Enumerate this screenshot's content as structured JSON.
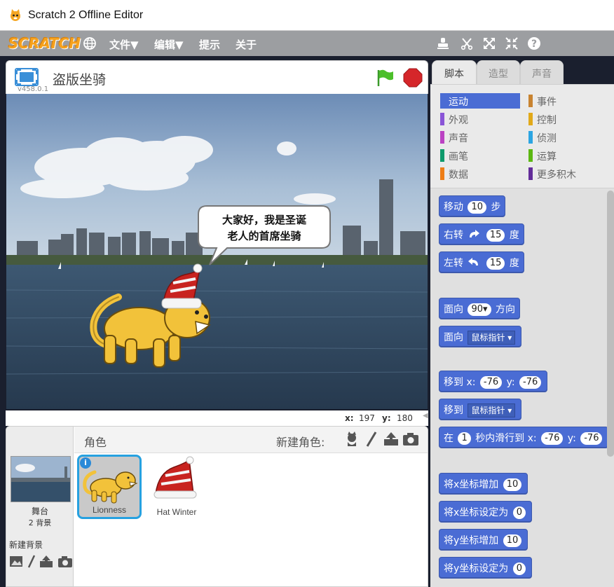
{
  "window": {
    "title": "Scratch 2 Offline Editor"
  },
  "menubar": {
    "logo": "SCRATCH",
    "items": [
      "文件▼",
      "编辑▼",
      "提示",
      "关于"
    ]
  },
  "stage": {
    "project_name": "盗版坐骑",
    "version": "v458.0.1",
    "speech_line1": "大家好，我是圣诞",
    "speech_line2": "老人的首席坐骑",
    "coords": {
      "x_label": "x:",
      "x_value": "197",
      "y_label": "y:",
      "y_value": "180"
    }
  },
  "sprites_pane": {
    "header_label": "角色",
    "new_sprite_label": "新建角色:",
    "stage_label": "舞台",
    "stage_backdrops": "2 背景",
    "new_backdrop_label": "新建背景",
    "sprites": [
      {
        "name": "Lionness",
        "selected": true
      },
      {
        "name": "Hat Winter",
        "selected": false
      }
    ]
  },
  "tabs": [
    "脚本",
    "造型",
    "声音"
  ],
  "categories": [
    {
      "label": "运动",
      "color": "#4a6cd4"
    },
    {
      "label": "外观",
      "color": "#8a55d7"
    },
    {
      "label": "声音",
      "color": "#bb42c3"
    },
    {
      "label": "画笔",
      "color": "#0e9a6c"
    },
    {
      "label": "数据",
      "color": "#ee7d16"
    },
    {
      "label": "事件",
      "color": "#c88330"
    },
    {
      "label": "控制",
      "color": "#e1a91a"
    },
    {
      "label": "侦测",
      "color": "#2ca5e2"
    },
    {
      "label": "运算",
      "color": "#5cb712"
    },
    {
      "label": "更多积木",
      "color": "#632d99"
    }
  ],
  "blocks": {
    "move": {
      "pre": "移动",
      "val": "10",
      "post": "步"
    },
    "turn_right": {
      "pre": "右转",
      "val": "15",
      "post": "度"
    },
    "turn_left": {
      "pre": "左转",
      "val": "15",
      "post": "度"
    },
    "point_dir": {
      "pre": "面向",
      "val": "90▾",
      "post": "方向"
    },
    "point_towards": {
      "pre": "面向",
      "drop": "鼠标指针"
    },
    "goto_xy": {
      "pre": "移到",
      "x_label": "x:",
      "x_val": "-76",
      "y_label": "y:",
      "y_val": "-76"
    },
    "goto": {
      "pre": "移到",
      "drop": "鼠标指针"
    },
    "glide": {
      "pre": "在",
      "secs": "1",
      "mid": "秒内滑行到",
      "x_label": "x:",
      "x_val": "-76",
      "y_label": "y:",
      "y_val": "-76"
    },
    "change_x": {
      "pre": "将x坐标增加",
      "val": "10"
    },
    "set_x": {
      "pre": "将x坐标设定为",
      "val": "0"
    },
    "change_y": {
      "pre": "将y坐标增加",
      "val": "10"
    },
    "set_y": {
      "pre": "将y坐标设定为",
      "val": "0"
    }
  },
  "colors": {
    "motion_block": "#4a6cd4",
    "menubar": "#9c9ea1",
    "selection": "#26a1e0",
    "lion": "#f2c23a"
  }
}
